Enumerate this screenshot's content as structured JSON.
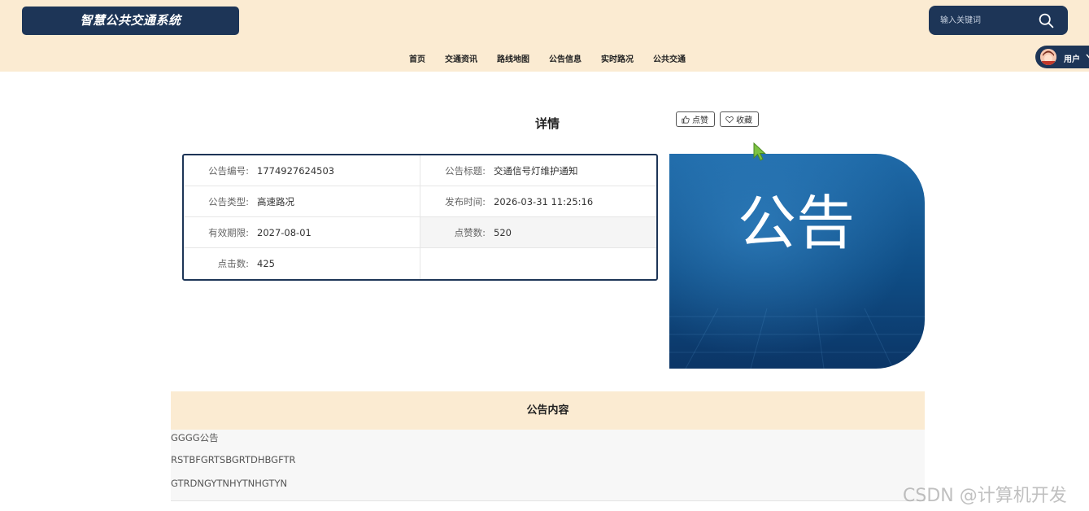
{
  "header": {
    "site_title": "智慧公共交通系统",
    "search_placeholder": "输入关键词",
    "nav": [
      "首页",
      "交通资讯",
      "路线地图",
      "公告信息",
      "实时路况",
      "公共交通"
    ],
    "user_label": "用户"
  },
  "detail": {
    "title": "详情",
    "like_label": "点赞",
    "favorite_label": "收藏",
    "fields": {
      "number_label": "公告编号:",
      "number_value": "1774927624503",
      "title_label": "公告标题:",
      "title_value": "交通信号灯维护通知",
      "type_label": "公告类型:",
      "type_value": "高速路况",
      "publish_label": "发布时间:",
      "publish_value": "2026-03-31 11:25:16",
      "expire_label": "有效期限:",
      "expire_value": "2027-08-01",
      "likes_label": "点赞数:",
      "likes_value": "520",
      "clicks_label": "点击数:",
      "clicks_value": "425"
    },
    "image_text": "公告"
  },
  "content": {
    "header": "公告内容",
    "lines": [
      "GGGG公告",
      "RSTBFGRTSBGRTDHBGFTR",
      "GTRDNGYTNHYTNHGTYN"
    ]
  },
  "watermark": "CSDN @计算机开发",
  "colors": {
    "primary_navy": "#1d3557",
    "header_bg": "#fbebd2",
    "image_blue": "#0f4d85"
  }
}
